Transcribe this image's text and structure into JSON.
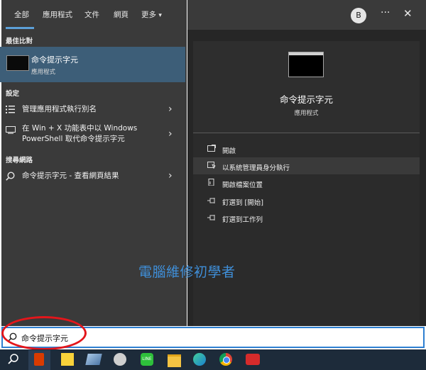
{
  "tabs": [
    {
      "label": "全部"
    },
    {
      "label": "應用程式"
    },
    {
      "label": "文件"
    },
    {
      "label": "網頁"
    },
    {
      "label": "更多"
    }
  ],
  "more_caret": "▾",
  "avatar_letter": "B",
  "more_options": "···",
  "close": "✕",
  "left": {
    "best_match_label": "最佳比對",
    "best_match": {
      "title": "命令提示字元",
      "subtitle": "應用程式"
    },
    "settings_label": "設定",
    "settings_items": [
      {
        "text": "管理應用程式執行別名"
      },
      {
        "line1": "在 Win + X 功能表中以 Windows",
        "line2": "PowerShell 取代命令提示字元"
      }
    ],
    "web_label": "搜尋網路",
    "web_item": {
      "text": "命令提示字元 - 查看網頁結果"
    }
  },
  "right": {
    "app_title": "命令提示字元",
    "app_subtitle": "應用程式",
    "actions": [
      {
        "label": "開啟",
        "icon": "open-icon"
      },
      {
        "label": "以系統管理員身分執行",
        "icon": "run-as-admin-icon"
      },
      {
        "label": "開啟檔案位置",
        "icon": "file-location-icon"
      },
      {
        "label": "釘選到 [開始]",
        "icon": "pin-icon"
      },
      {
        "label": "釘選到工作列",
        "icon": "pin-icon"
      }
    ]
  },
  "watermark": "電腦維修初學者",
  "search": {
    "value": "命令提示字元"
  },
  "colors": {
    "accent": "#3d5e78",
    "highlight_oval": "#e3161b",
    "search_border": "#2d7fd1",
    "watermark": "#3f8fd9"
  },
  "taskbar_icons": [
    "search-icon",
    "office-icon",
    "sticky-notes-icon",
    "app-icon",
    "paint-icon",
    "line-icon",
    "file-explorer-icon",
    "edge-icon",
    "chrome-icon",
    "ccleaner-icon"
  ]
}
